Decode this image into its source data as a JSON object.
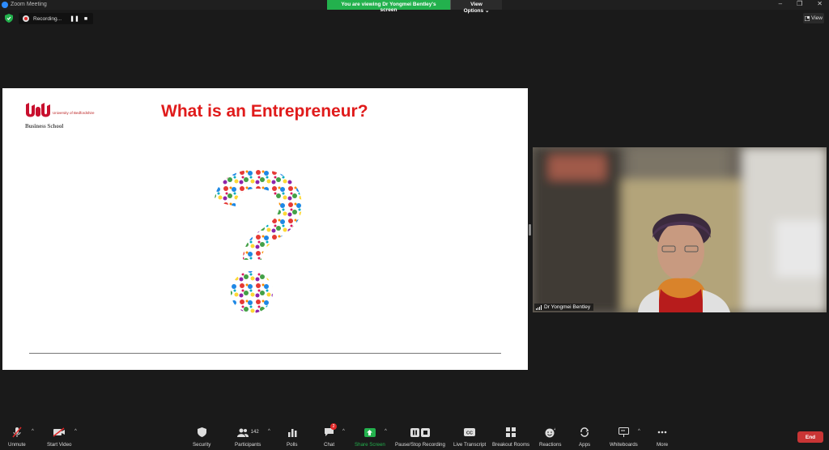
{
  "window": {
    "title": "Zoom Meeting",
    "controls": [
      "–",
      "❐",
      "✕"
    ]
  },
  "banner": {
    "viewing_text": "You are viewing Dr Yongmei Bentley's screen",
    "view_options_label": "View Options ⌄"
  },
  "topbar": {
    "recording_label": "Recording...",
    "pause_glyph": "❚❚",
    "stop_glyph": "■",
    "view_label": "View"
  },
  "slide": {
    "title": "What is an Entrepreneur?",
    "logo_university": "University of Bedfordshire",
    "logo_school": "Business School"
  },
  "video": {
    "participant_name": "Dr Yongmei Bentley"
  },
  "toolbar": {
    "unmute": "Unmute",
    "start_video": "Start Video",
    "security": "Security",
    "participants": "Participants",
    "participants_count": "142",
    "polls": "Polls",
    "chat": "Chat",
    "chat_badge": "2",
    "share_screen": "Share Screen",
    "pause_stop_recording": "Pause/Stop Recording",
    "live_transcript": "Live Transcript",
    "breakout_rooms": "Breakout Rooms",
    "reactions": "Reactions",
    "apps": "Apps",
    "whiteboards": "Whiteboards",
    "more": "More",
    "end": "End"
  },
  "colors": {
    "share_green": "#23b14d",
    "end_red": "#c93535",
    "slide_title_red": "#e01b1b",
    "zoom_blue": "#2d8cff"
  }
}
